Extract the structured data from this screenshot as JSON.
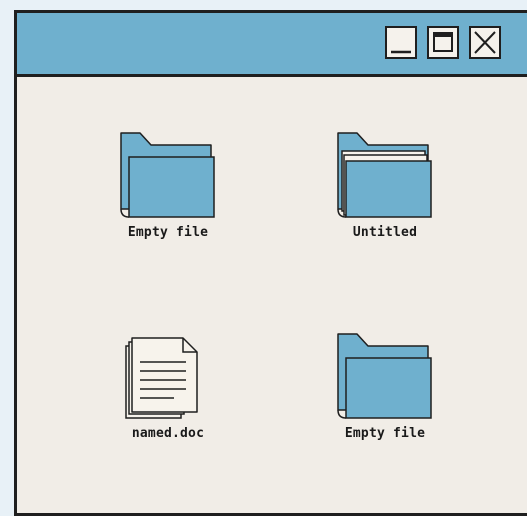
{
  "window": {
    "buttons": {
      "minimize": "minimize-icon",
      "maximize": "maximize-icon",
      "close": "close-icon"
    }
  },
  "items": [
    {
      "label": "Empty file",
      "icon": "folder-icon"
    },
    {
      "label": "Untitled",
      "icon": "folder-with-papers-icon"
    },
    {
      "label": "named.doc",
      "icon": "document-icon"
    },
    {
      "label": "Empty file",
      "icon": "folder-icon"
    }
  ],
  "colors": {
    "titlebar": "#6fb0ce",
    "folder": "#6fb0ce",
    "window_background": "#f1ede7",
    "page_background": "#e8f1f7",
    "outline": "#1f1f1f"
  }
}
